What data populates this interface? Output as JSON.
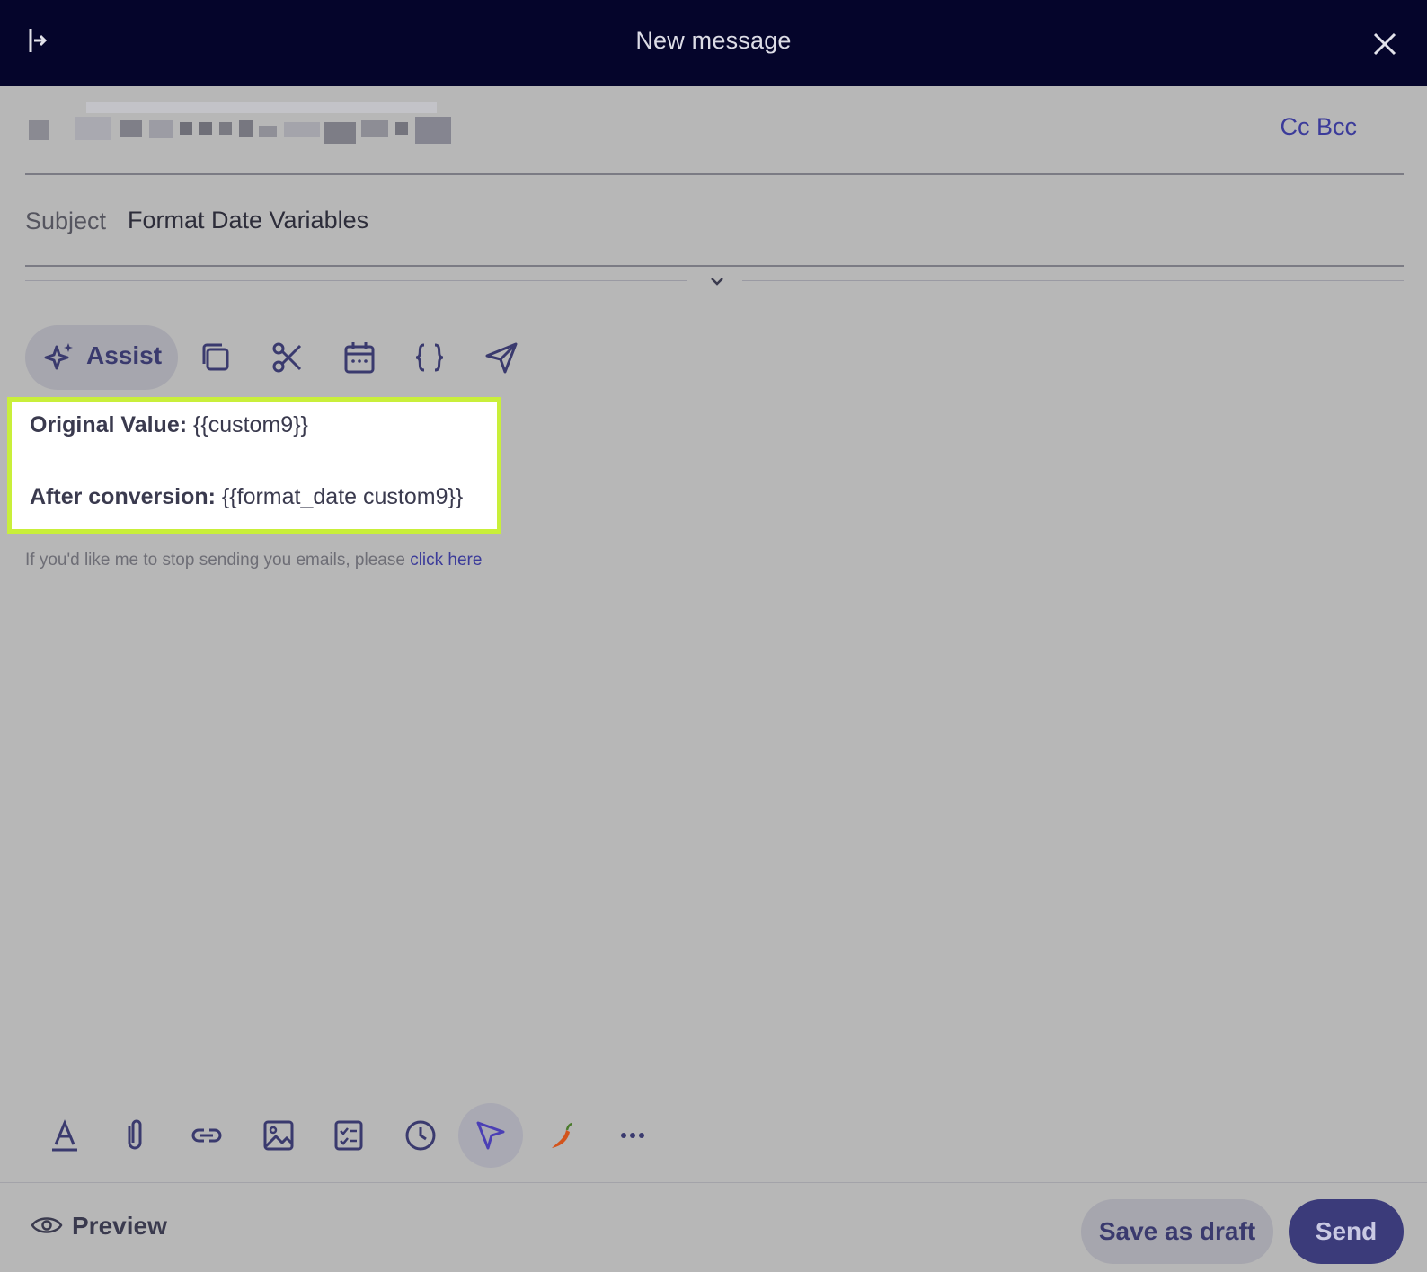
{
  "header": {
    "title": "New message",
    "collapse_icon": "collapse-sidebar-icon",
    "close_icon": "close-icon"
  },
  "recipients": {
    "cc_bcc_label": "Cc Bcc"
  },
  "subject": {
    "label": "Subject",
    "value": "Format Date Variables"
  },
  "toolbar_top": {
    "assist_label": "Assist",
    "icons": [
      "sparkle-icon",
      "copy-icon",
      "scissors-icon",
      "calendar-icon",
      "braces-icon",
      "send-icon"
    ]
  },
  "body": {
    "line1_label": "Original Value:",
    "line1_value": " {{custom9}}",
    "line2_label": "After conversion:",
    "line2_value": " {{format_date custom9}}",
    "unsubscribe_text": "If you'd like me to stop sending you emails, please ",
    "unsubscribe_link": "click here"
  },
  "toolbar_bottom": {
    "icons": [
      "text-format-icon",
      "attachment-icon",
      "link-icon",
      "image-icon",
      "checklist-icon",
      "clock-icon",
      "cursor-tracking-icon",
      "pepper-icon",
      "more-icon"
    ]
  },
  "footer": {
    "preview_label": "Preview",
    "save_draft_label": "Save as draft",
    "send_label": "Send"
  },
  "colors": {
    "header_bg": "#05052b",
    "highlight_border": "#c9ef3a",
    "accent": "#3b3b9a",
    "send_bg": "#3b3b7a"
  }
}
